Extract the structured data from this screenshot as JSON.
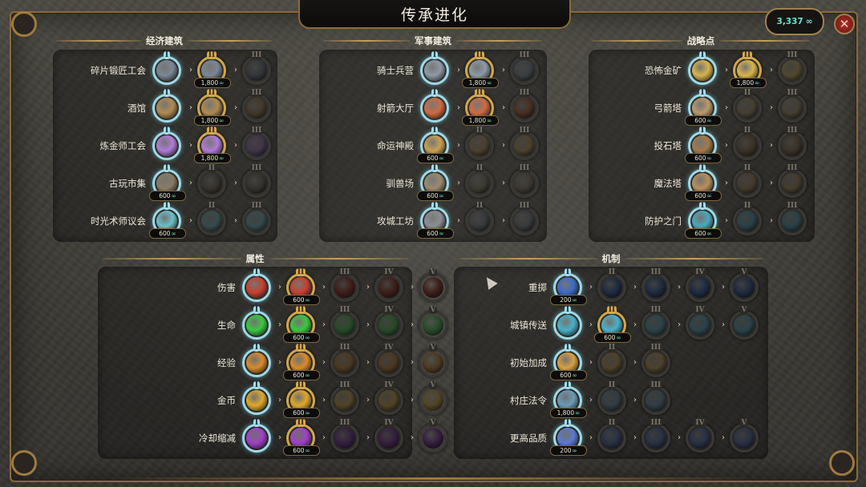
{
  "title": "传承进化",
  "currency": {
    "amount": "3,337",
    "icon": "legacy-points-icon"
  },
  "close_icon": "close-icon",
  "sections": [
    {
      "name": "经济建筑",
      "rows": [
        {
          "label": "碎片锻匠工会",
          "icon": "anvil-icon",
          "color": "#7a8794",
          "tiers": 3,
          "unlocked": 2,
          "cost": "1,800"
        },
        {
          "label": "酒馆",
          "icon": "beer-mug-icon",
          "color": "#b08a50",
          "tiers": 3,
          "unlocked": 2,
          "cost": "1,800"
        },
        {
          "label": "炼金师工会",
          "icon": "potion-flask-icon",
          "color": "#b07ad8",
          "tiers": 3,
          "unlocked": 2,
          "cost": "1,800"
        },
        {
          "label": "古玩市集",
          "icon": "market-tent-icon",
          "color": "#8a7a64",
          "tiers": 3,
          "unlocked": 1,
          "cost": "600"
        },
        {
          "label": "时光术师议会",
          "icon": "chronomancer-shield-icon",
          "color": "#6ac0c8",
          "tiers": 3,
          "unlocked": 1,
          "cost": "600"
        }
      ]
    },
    {
      "name": "军事建筑",
      "rows": [
        {
          "label": "骑士兵营",
          "icon": "crossed-hammers-icon",
          "color": "#8c9aa6",
          "tiers": 3,
          "unlocked": 2,
          "cost": "1,800"
        },
        {
          "label": "射箭大厅",
          "icon": "target-icon",
          "color": "#d06a40",
          "tiers": 3,
          "unlocked": 2,
          "cost": "1,800"
        },
        {
          "label": "命运神殿",
          "icon": "bell-icon",
          "color": "#c8a050",
          "tiers": 3,
          "unlocked": 1,
          "cost": "600"
        },
        {
          "label": "驯兽场",
          "icon": "claw-marks-icon",
          "color": "#9a8a70",
          "tiers": 3,
          "unlocked": 1,
          "cost": "600"
        },
        {
          "label": "攻城工坊",
          "icon": "gear-icon",
          "color": "#8a8f96",
          "tiers": 3,
          "unlocked": 1,
          "cost": "600"
        }
      ]
    },
    {
      "name": "战略点",
      "rows": [
        {
          "label": "恐怖金矿",
          "icon": "crossed-pickaxes-icon",
          "color": "#d8b44a",
          "tiers": 3,
          "unlocked": 2,
          "cost": "1,800"
        },
        {
          "label": "弓箭塔",
          "icon": "crossed-arrows-icon",
          "color": "#b89a6a",
          "tiers": 3,
          "unlocked": 1,
          "cost": "600"
        },
        {
          "label": "投石塔",
          "icon": "catapult-icon",
          "color": "#a07a4a",
          "tiers": 3,
          "unlocked": 1,
          "cost": "600"
        },
        {
          "label": "魔法塔",
          "icon": "magic-tower-icon",
          "color": "#b8905a",
          "tiers": 3,
          "unlocked": 1,
          "cost": "600"
        },
        {
          "label": "防护之门",
          "icon": "shield-gate-icon",
          "color": "#4aa8c0",
          "tiers": 3,
          "unlocked": 1,
          "cost": "600"
        }
      ]
    },
    {
      "name": "属性",
      "rows": [
        {
          "label": "伤害",
          "icon": "sword-icon",
          "color": "#c84030",
          "tiers": 5,
          "unlocked": 2,
          "cost": "600"
        },
        {
          "label": "生命",
          "icon": "health-cross-icon",
          "color": "#3ac840",
          "tiers": 5,
          "unlocked": 2,
          "cost": "600"
        },
        {
          "label": "经验",
          "icon": "chevron-rank-icon",
          "color": "#d88a2a",
          "tiers": 5,
          "unlocked": 2,
          "cost": "600"
        },
        {
          "label": "金币",
          "icon": "gold-coins-icon",
          "color": "#e0a828",
          "tiers": 5,
          "unlocked": 2,
          "cost": "600"
        },
        {
          "label": "冷却缩减",
          "icon": "swirl-icon",
          "color": "#a040c8",
          "tiers": 5,
          "unlocked": 2,
          "cost": "600"
        }
      ]
    },
    {
      "name": "机制",
      "rows": [
        {
          "label": "重掷",
          "icon": "dice-icon",
          "color": "#3a6ac8",
          "tiers": 5,
          "unlocked": 1,
          "cost": "200"
        },
        {
          "label": "城镇传送",
          "icon": "teleport-icon",
          "color": "#4ab0c8",
          "tiers": 5,
          "unlocked": 2,
          "cost": "600"
        },
        {
          "label": "初始加成",
          "icon": "bonus-cross-icon",
          "color": "#d8a040",
          "tiers": 3,
          "unlocked": 1,
          "cost": "600"
        },
        {
          "label": "村庄法令",
          "icon": "scroll-decree-icon",
          "color": "#6a9ab8",
          "tiers": 3,
          "unlocked": 1,
          "cost": "1,800"
        },
        {
          "label": "更高品质",
          "icon": "crystal-icon",
          "color": "#5a7ad0",
          "tiers": 5,
          "unlocked": 1,
          "cost": "200"
        }
      ]
    }
  ],
  "roman_numerals": [
    "I",
    "II",
    "III",
    "IV",
    "V"
  ]
}
